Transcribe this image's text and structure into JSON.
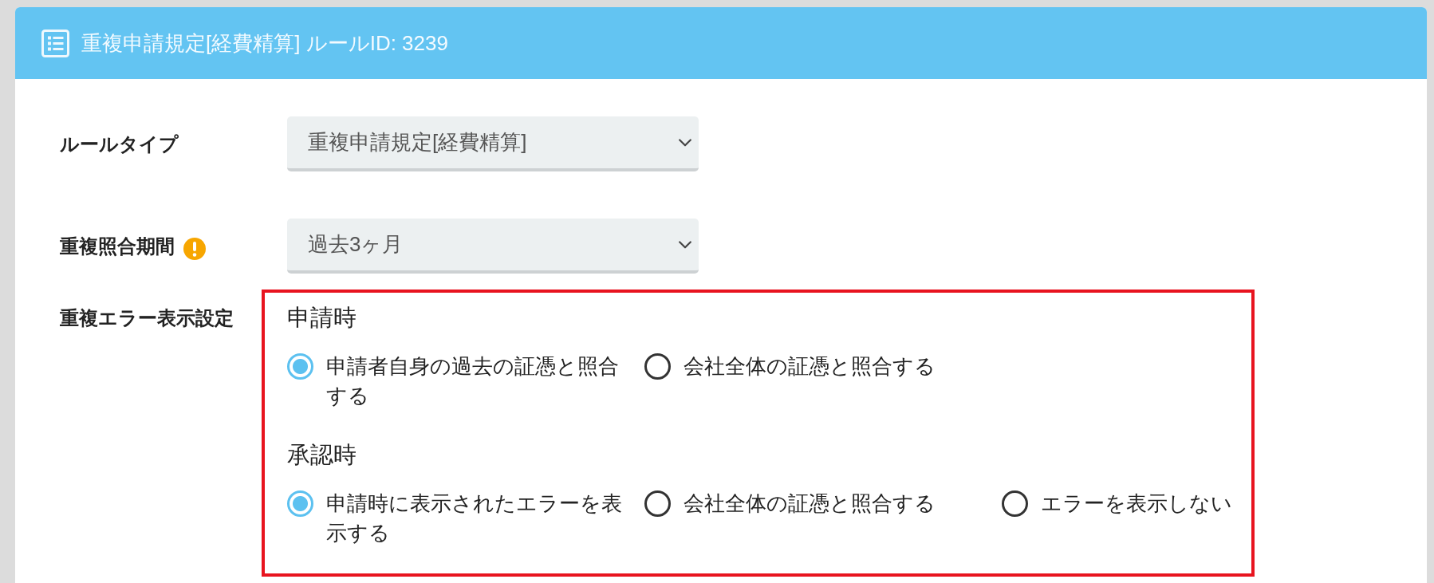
{
  "panel": {
    "title": "重複申請規定[経費精算] ルールID: 3239"
  },
  "fields": [
    {
      "kind": "select",
      "label": "ルールタイプ",
      "value": "重複申請規定[経費精算]",
      "warning": false
    },
    {
      "kind": "select",
      "label": "重複照合期間",
      "value": "過去3ヶ月",
      "warning": true
    },
    {
      "kind": "radio_groups",
      "label": "重複エラー表示設定",
      "highlighted": true,
      "groups": [
        {
          "heading": "申請時",
          "options": [
            {
              "label": "申請者自身の過去の証憑と照合する",
              "selected": true
            },
            {
              "label": "会社全体の証憑と照合する",
              "selected": false
            }
          ]
        },
        {
          "heading": "承認時",
          "options": [
            {
              "label": "申請時に表示されたエラーを表示する",
              "selected": true
            },
            {
              "label": "会社全体の証憑と照合する",
              "selected": false
            },
            {
              "label": "エラーを表示しない",
              "selected": false
            }
          ]
        }
      ]
    }
  ]
}
